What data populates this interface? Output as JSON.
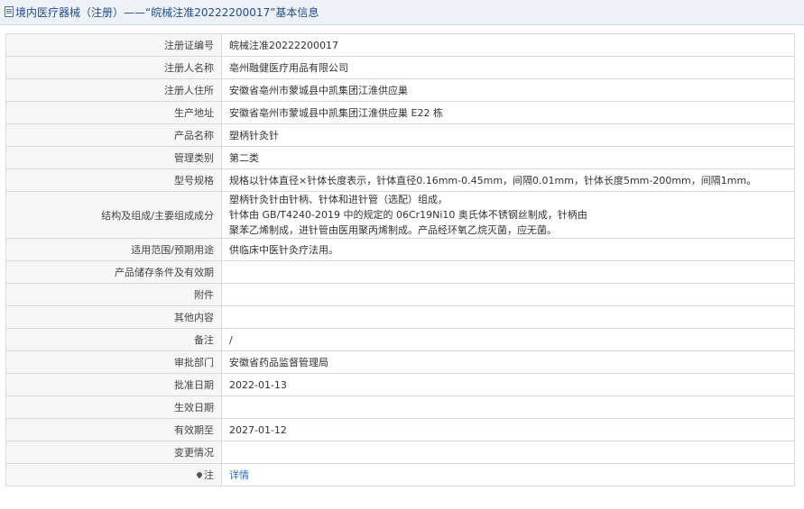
{
  "header": {
    "title": "境内医疗器械（注册）——“皖械注准20222200017”基本信息"
  },
  "rows": [
    {
      "label": "注册证编号",
      "value": "皖械注准20222200017"
    },
    {
      "label": "注册人名称",
      "value": "亳州融健医疗用品有限公司"
    },
    {
      "label": "注册人住所",
      "value": "安徽省亳州市蒙城县中凯集团江淮供应巢"
    },
    {
      "label": "生产地址",
      "value": "安徽省亳州市蒙城县中凯集团江淮供应巢 E22 栋"
    },
    {
      "label": "产品名称",
      "value": "塑柄针灸针"
    },
    {
      "label": "管理类别",
      "value": "第二类"
    },
    {
      "label": "型号规格",
      "value": "规格以针体直径×针体长度表示，针体直径0.16mm-0.45mm，间隔0.01mm，针体长度5mm-200mm，间隔1mm。"
    },
    {
      "label": "结构及组成/主要组成成分",
      "lines": [
        "塑柄针灸针由针柄、针体和进针管（选配）组成，",
        "针体由 GB/T4240-2019 中的规定的 06Cr19Ni10 奥氏体不锈钢丝制成，针柄由",
        "聚苯乙烯制成，进针管由医用聚丙烯制成。产品经环氧乙烷灭菌，应无菌。"
      ]
    },
    {
      "label": "适用范围/预期用途",
      "value": "供临床中医针灸疗法用。"
    },
    {
      "label": "产品储存条件及有效期",
      "value": ""
    },
    {
      "label": "附件",
      "value": ""
    },
    {
      "label": "其他内容",
      "value": ""
    },
    {
      "label": "备注",
      "value": "/"
    },
    {
      "label": "审批部门",
      "value": "安徽省药品监督管理局"
    },
    {
      "label": "批准日期",
      "value": "2022-01-13"
    },
    {
      "label": "生效日期",
      "value": ""
    },
    {
      "label": "有效期至",
      "value": "2027-01-12"
    },
    {
      "label": "变更情况",
      "value": ""
    },
    {
      "label": "注",
      "value": "详情",
      "icon": "map-pin-icon"
    }
  ]
}
